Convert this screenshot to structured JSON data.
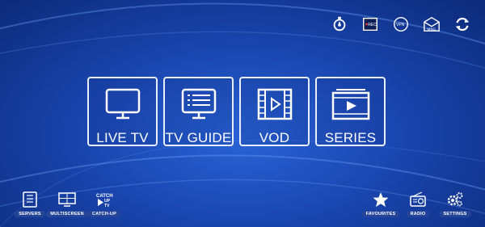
{
  "top_icons": [
    {
      "name": "timer-icon"
    },
    {
      "name": "record-icon",
      "text": "REC"
    },
    {
      "name": "vpn-icon",
      "text": "VPN"
    },
    {
      "name": "messages-icon",
      "text": "MSG"
    },
    {
      "name": "refresh-icon"
    }
  ],
  "tiles": [
    {
      "label": "LIVE TV",
      "icon": "tv-icon"
    },
    {
      "label": "TV GUIDE",
      "icon": "tv-guide-icon"
    },
    {
      "label": "VOD",
      "icon": "film-icon"
    },
    {
      "label": "SERIES",
      "icon": "series-icon"
    }
  ],
  "bottom_left": [
    {
      "label": "SERVERS",
      "icon": "servers-icon"
    },
    {
      "label": "MULTISCREEN",
      "icon": "multiscreen-icon"
    },
    {
      "label": "CATCH-UP",
      "icon": "catch-up-icon",
      "text": "CATCH UP TV"
    }
  ],
  "bottom_right": [
    {
      "label": "FAVOURITES",
      "icon": "star-icon"
    },
    {
      "label": "RADIO",
      "icon": "radio-icon"
    },
    {
      "label": "SETTINGS",
      "icon": "gear-icon"
    }
  ],
  "colors": {
    "accent": "#e8eefc",
    "background": "#1a46b0"
  }
}
